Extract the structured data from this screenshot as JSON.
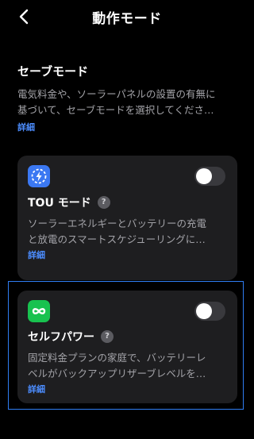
{
  "header": {
    "title": "動作モード"
  },
  "section": {
    "title": "セーブモード",
    "description_line1": "電気料金や、ソーラーパネルの設置の有無に",
    "description_line2": "基づいて、セーブモードを選択してくださ…",
    "detail_label": "詳細"
  },
  "modes": [
    {
      "title": "TOU モード",
      "help": "?",
      "description_line1": "ソーラーエネルギーとバッテリーの充電",
      "description_line2": "と放電のスマートスケジューリングに…",
      "detail_label": "詳細",
      "enabled": false,
      "icon": "schedule-bolt-icon",
      "icon_color": "#3b78f2"
    },
    {
      "title": "セルフパワー",
      "help": "?",
      "description_line1": "固定料金プランの家庭で、バッテリーレ",
      "description_line2": "ベルがバックアップリザーブレベルを…",
      "detail_label": "詳細",
      "enabled": false,
      "selected": true,
      "icon": "infinity-icon",
      "icon_color": "#18c24f"
    }
  ],
  "colors": {
    "accent": "#4c8dff",
    "selection": "#2f7df3",
    "card": "#1e1e20",
    "background": "#000000"
  }
}
